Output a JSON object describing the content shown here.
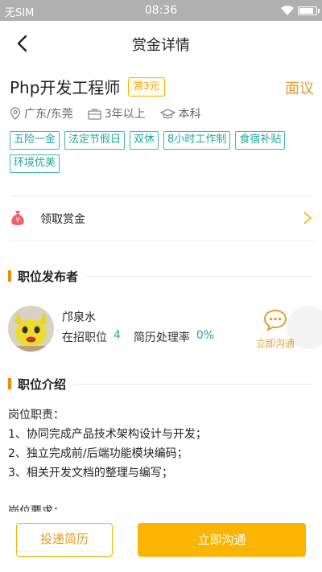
{
  "status_bar": {
    "carrier": "无SIM",
    "time": "08:36"
  },
  "nav": {
    "title": "赏金详情"
  },
  "job": {
    "title": "Php开发工程师",
    "bounty": "赏3元",
    "salary": "面议",
    "location": "广东/东莞",
    "experience": "3年以上",
    "education": "本科",
    "tags": [
      "五险一金",
      "法定节假日",
      "双休",
      "8小时工作制",
      "食宿补贴",
      "环境优美"
    ]
  },
  "claim": {
    "label": "领取赏金"
  },
  "publisher_section": {
    "title": "职位发布者"
  },
  "publisher": {
    "name": "邝泉水",
    "open_positions_label": "在招职位",
    "open_positions": "4",
    "resume_rate_label": "简历处理率",
    "resume_rate": "0%",
    "chat_label": "立即沟通"
  },
  "intro_section": {
    "title": "职位介绍"
  },
  "description": {
    "lines": [
      "岗位职责：",
      "1、协同完成产品技术架构设计与开发；",
      "2、独立完成前/后端功能模块编码；",
      "3、相关开发文档的整理与编写；",
      "",
      "岗位要求："
    ]
  },
  "actions": {
    "resume_label": "投递简历",
    "chat_label": "立即沟通"
  },
  "colors": {
    "accent_orange": "#fbb400",
    "teal": "#1fa79f",
    "section_bar": "#f08a00"
  }
}
